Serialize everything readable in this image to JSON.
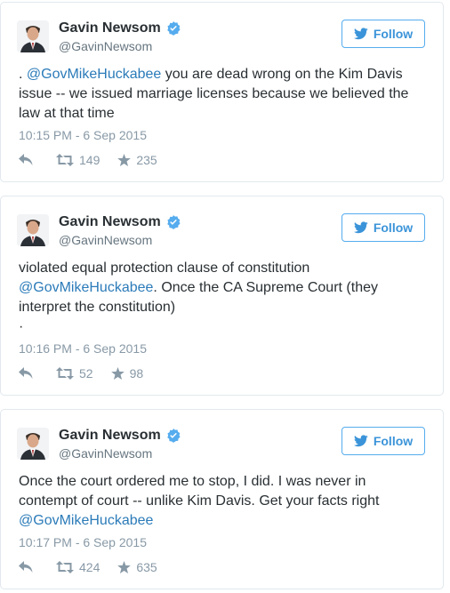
{
  "colors": {
    "link": "#2b7bb9",
    "follow_blue": "#3b94d9",
    "muted": "#8899a6",
    "verified": "#55acee"
  },
  "tweets": [
    {
      "author": {
        "name": "Gavin Newsom",
        "handle": "@GavinNewsom"
      },
      "follow_label": "Follow",
      "text_parts": [
        ". ",
        "@GovMikeHuckabee",
        " you are dead wrong on the Kim Davis issue -- we issued marriage licenses because we believed the law at that time"
      ],
      "timestamp": "10:15 PM - 6 Sep 2015",
      "retweets": "149",
      "favorites": "235"
    },
    {
      "author": {
        "name": "Gavin Newsom",
        "handle": "@GavinNewsom"
      },
      "follow_label": "Follow",
      "text_parts": [
        "violated equal protection clause of constitution ",
        "@GovMikeHuckabee",
        ". Once the CA Supreme Court (they interpret the constitution)",
        "·"
      ],
      "timestamp": "10:16 PM - 6 Sep 2015",
      "retweets": "52",
      "favorites": "98"
    },
    {
      "author": {
        "name": "Gavin Newsom",
        "handle": "@GavinNewsom"
      },
      "follow_label": "Follow",
      "text_parts": [
        "Once the court ordered me to stop, I did. I was never in contempt of court -- unlike Kim Davis. Get your facts right ",
        "@GovMikeHuckabee"
      ],
      "timestamp": "10:17 PM - 6 Sep 2015",
      "retweets": "424",
      "favorites": "635"
    }
  ]
}
